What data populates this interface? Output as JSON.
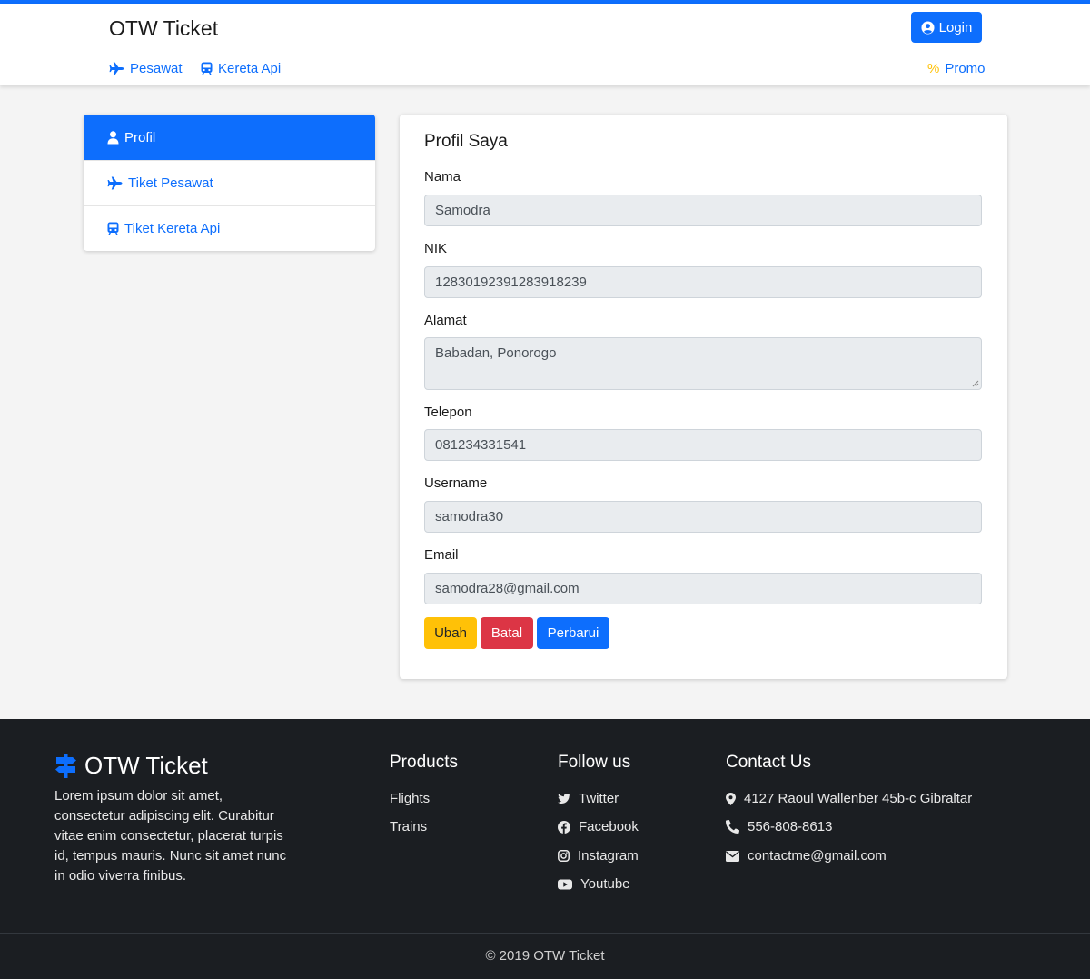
{
  "header": {
    "brand": "OTW Ticket",
    "login_label": "Login",
    "nav": {
      "pesawat": "Pesawat",
      "kereta": "Kereta Api",
      "promo": "Promo",
      "promo_symbol": "%"
    }
  },
  "sidebar": {
    "items": [
      {
        "label": "Profil",
        "icon": "user-icon",
        "active": true
      },
      {
        "label": "Tiket Pesawat",
        "icon": "plane-icon",
        "active": false
      },
      {
        "label": "Tiket Kereta Api",
        "icon": "train-icon",
        "active": false
      }
    ]
  },
  "profile": {
    "title": "Profil Saya",
    "fields": {
      "nama": {
        "label": "Nama",
        "value": "Samodra"
      },
      "nik": {
        "label": "NIK",
        "value": "12830192391283918239"
      },
      "alamat": {
        "label": "Alamat",
        "value": "Babadan, Ponorogo"
      },
      "telepon": {
        "label": "Telepon",
        "value": "081234331541"
      },
      "username": {
        "label": "Username",
        "value": "samodra30"
      },
      "email": {
        "label": "Email",
        "value": "samodra28@gmail.com"
      }
    },
    "buttons": {
      "ubah": "Ubah",
      "batal": "Batal",
      "perbarui": "Perbarui"
    }
  },
  "footer": {
    "brand": "OTW Ticket",
    "description": "Lorem ipsum dolor sit amet, consectetur adipiscing elit. Curabitur vitae enim consectetur, placerat turpis id, tempus mauris. Nunc sit amet nunc in odio viverra finibus.",
    "products": {
      "title": "Products",
      "items": [
        "Flights",
        "Trains"
      ]
    },
    "follow": {
      "title": "Follow us",
      "items": [
        "Twitter",
        "Facebook",
        "Instagram",
        "Youtube"
      ]
    },
    "contact": {
      "title": "Contact Us",
      "address": "4127 Raoul Wallenber 45b-c Gibraltar",
      "phone": "556-808-8613",
      "email": "contactme@gmail.com"
    },
    "copyright": "© 2019 OTW Ticket"
  },
  "colors": {
    "primary": "#0d6efd",
    "warning": "#ffc107",
    "danger": "#dc3545",
    "footer_bg": "#1b1e22"
  }
}
